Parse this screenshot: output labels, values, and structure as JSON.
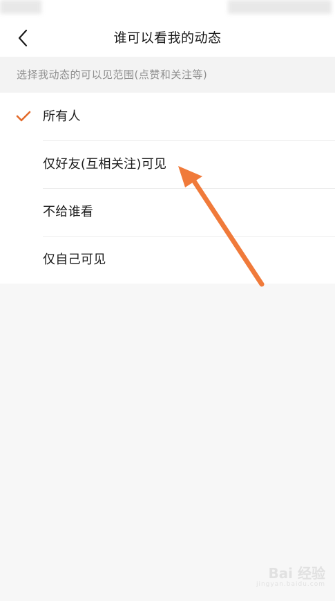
{
  "header": {
    "title": "谁可以看我的动态"
  },
  "subtitle": "选择我动态的可以见范围(点赞和关注等)",
  "options": [
    {
      "label": "所有人",
      "selected": true
    },
    {
      "label": "仅好友(互相关注)可见",
      "selected": false
    },
    {
      "label": "不给谁看",
      "selected": false
    },
    {
      "label": "仅自己可见",
      "selected": false
    }
  ],
  "colors": {
    "accent": "#e36a2a",
    "arrow": "#f07a3a"
  },
  "watermark": {
    "brand": "Bai 经验",
    "site": "jingyan.baidu.com"
  }
}
